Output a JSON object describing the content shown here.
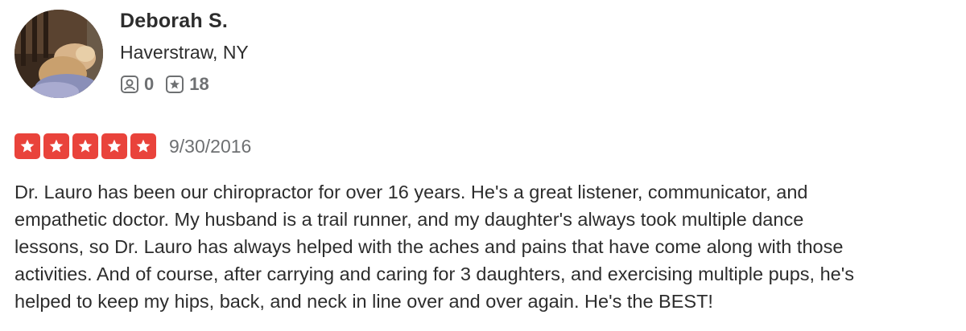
{
  "user": {
    "name": "Deborah S.",
    "location": "Haverstraw, NY",
    "friends_count": "0",
    "reviews_count": "18",
    "friends_icon": "friends-icon",
    "reviews_icon": "review-star-icon"
  },
  "review": {
    "rating": 5,
    "max_rating": 5,
    "star_color": "#e9433b",
    "date": "9/30/2016",
    "text": "Dr. Lauro has been our chiropractor for over 16 years. He's a great listener, communicator, and\nempathetic doctor. My husband is a trail runner, and my daughter's always took multiple dance\nlessons, so Dr. Lauro has always helped with the aches and pains that have come along with those\nactivities. And of course, after carrying and caring for 3 daughters, and exercising multiple pups, he's\nhelped to keep my hips, back, and neck in line over and over again. He's the BEST!"
  }
}
